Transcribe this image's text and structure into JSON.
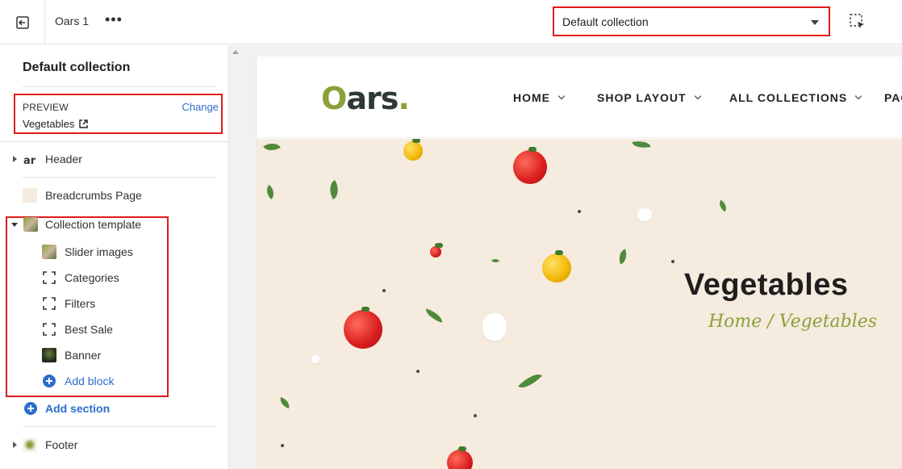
{
  "topbar": {
    "theme_name": "Oars 1",
    "more_label": "•••",
    "template_select": "Default collection"
  },
  "sidebar": {
    "title": "Default collection",
    "preview": {
      "label": "PREVIEW",
      "change": "Change",
      "value": "Vegetables"
    },
    "sections": {
      "header": "Header",
      "breadcrumbs": "Breadcrumbs Page",
      "collection_template": "Collection template",
      "blocks": [
        "Slider images",
        "Categories",
        "Filters",
        "Best Sale",
        "Banner"
      ],
      "add_block": "Add block",
      "add_section": "Add section",
      "footer": "Footer"
    }
  },
  "preview": {
    "logo": {
      "o": "O",
      "rest": "ars",
      "dot": "."
    },
    "nav": [
      "HOME",
      "SHOP LAYOUT",
      "ALL COLLECTIONS",
      "PAG"
    ],
    "hero": {
      "title": "Vegetables",
      "breadcrumb": "Home / Vegetables"
    }
  },
  "colors": {
    "highlight": "#e01b1b",
    "link": "#2c6ecb",
    "brand_green": "#8aa13a",
    "hero_bg": "#f5ebdf"
  },
  "icons": [
    "exit-icon",
    "more-icon",
    "chevron-down-icon",
    "inspect-icon",
    "external-link-icon",
    "caret-right-icon",
    "caret-down-icon",
    "add-circle-icon"
  ]
}
